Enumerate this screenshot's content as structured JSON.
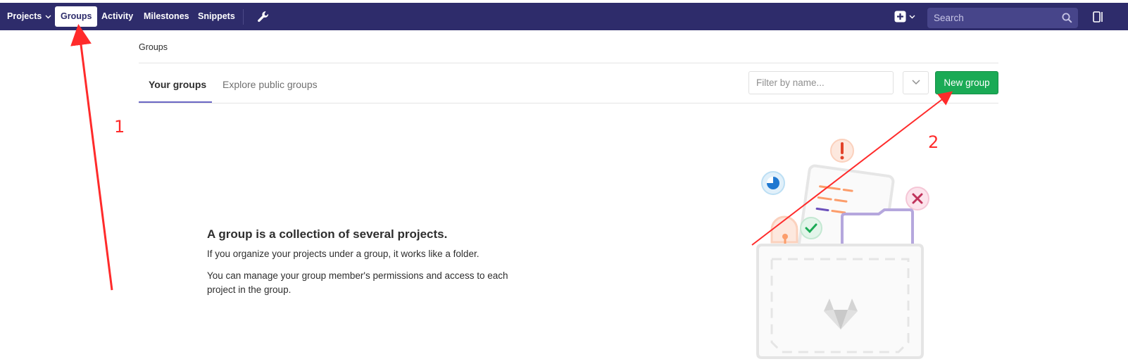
{
  "navbar": {
    "items": [
      {
        "label": "Projects",
        "has_dropdown": true
      },
      {
        "label": "Groups",
        "active": true
      },
      {
        "label": "Activity"
      },
      {
        "label": "Milestones"
      },
      {
        "label": "Snippets"
      }
    ],
    "admin_icon": "wrench-icon",
    "new_icon": "plus-square-icon",
    "search_placeholder": "Search",
    "background_color": "#2e2c6b"
  },
  "breadcrumb": "Groups",
  "tabs": [
    {
      "label": "Your groups",
      "active": true
    },
    {
      "label": "Explore public groups",
      "active": false
    }
  ],
  "filter": {
    "placeholder": "Filter by name..."
  },
  "new_group_button": {
    "label": "New group",
    "color": "#1aaa55"
  },
  "empty_state": {
    "title": "A group is a collection of several projects.",
    "paragraph1": "If you organize your projects under a group, it works like a folder.",
    "paragraph2": "You can manage your group member's permissions and access to each project in the group."
  },
  "annotations": {
    "color": "#ff2b2b",
    "labels": [
      "1",
      "2"
    ]
  }
}
